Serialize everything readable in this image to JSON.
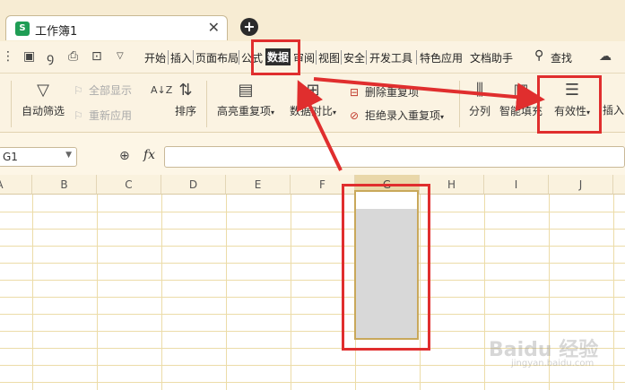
{
  "window": {
    "tab_title": "工作簿1",
    "tab_icon": "S",
    "close_glyph": "✕",
    "add_glyph": "+"
  },
  "menu": {
    "items": [
      "开始",
      "插入",
      "页面布局",
      "公式",
      "数据",
      "审阅",
      "视图",
      "安全",
      "开发工具",
      "特色应用",
      "文档助手"
    ],
    "active": "数据",
    "search_label": "查找"
  },
  "ribbon": {
    "auto_filter": "自动筛选",
    "show_all": "全部显示",
    "reapply": "重新应用",
    "sort": "排序",
    "highlight_dup": "高亮重复项",
    "data_compare": "数据对比",
    "delete_dup": "删除重复项",
    "reject_dup": "拒绝录入重复项",
    "split_column": "分列",
    "smart_fill": "智能填充",
    "validity": "有效性",
    "insert_dropdown": "插入",
    "dropdown_caret": "▾"
  },
  "formula_bar": {
    "name_box": "G1",
    "fx": "fx",
    "formula": ""
  },
  "grid": {
    "columns": [
      "A",
      "B",
      "C",
      "D",
      "E",
      "F",
      "G",
      "H",
      "I",
      "J"
    ],
    "selected_column": "G"
  },
  "colors": {
    "highlight_red": "#e02e2e",
    "selection_border": "#c9a85a",
    "selection_fill": "#d8d8d8"
  },
  "watermark": {
    "main": "Baidu 经验",
    "sub": "jingyan.baidu.com"
  }
}
